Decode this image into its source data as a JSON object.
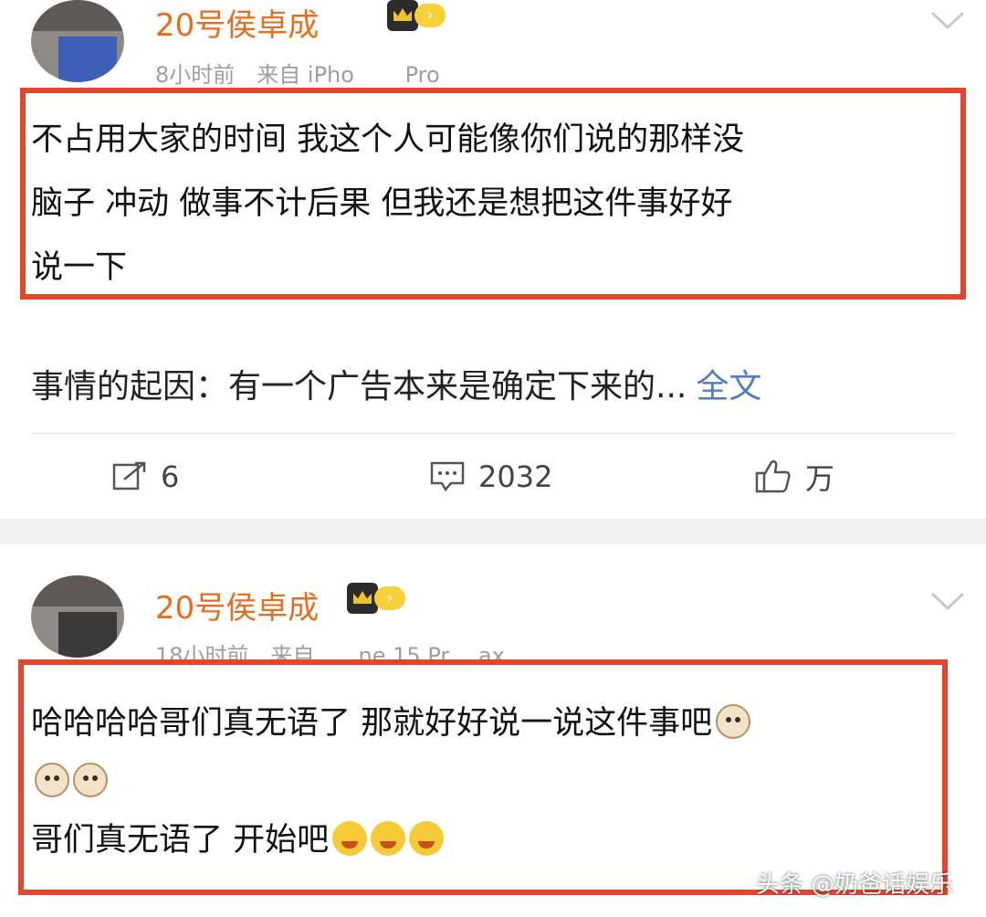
{
  "post1": {
    "username": "20号侯卓成",
    "badge_icon": "crown-badge",
    "time": "8小时前",
    "source": "来自 iPho　　 Pro",
    "content_lines": [
      "不占用大家的时间 我这个人可能像你们说的那样没",
      "脑子 冲动 做事不计后果 但我还是想把这件事好好",
      "说一下"
    ],
    "summary": "事情的起因：有一个广告本来是确定下来的...",
    "full_text_link": "全文",
    "actions": {
      "repost_count": "6",
      "comment_count": "2032",
      "like_count": "万"
    }
  },
  "post2": {
    "username": "20号侯卓成",
    "badge_icon": "crown-badge",
    "time": "18小时前",
    "source": "来自　　ne 15 Pr　 ax",
    "content_line1": "哈哈哈哈哥们真无语了 那就好好说一说这件事吧",
    "content_line3": "哥们真无语了 开始吧",
    "emojis": [
      "cat-face-emoji",
      "blushing-face-emoji"
    ]
  },
  "watermark": "头条 @奶爸话娱乐",
  "colors": {
    "username": "#e86c1b",
    "highlight_border": "#e4452f",
    "link": "#4f7ec0",
    "meta": "#9e9e9e"
  }
}
